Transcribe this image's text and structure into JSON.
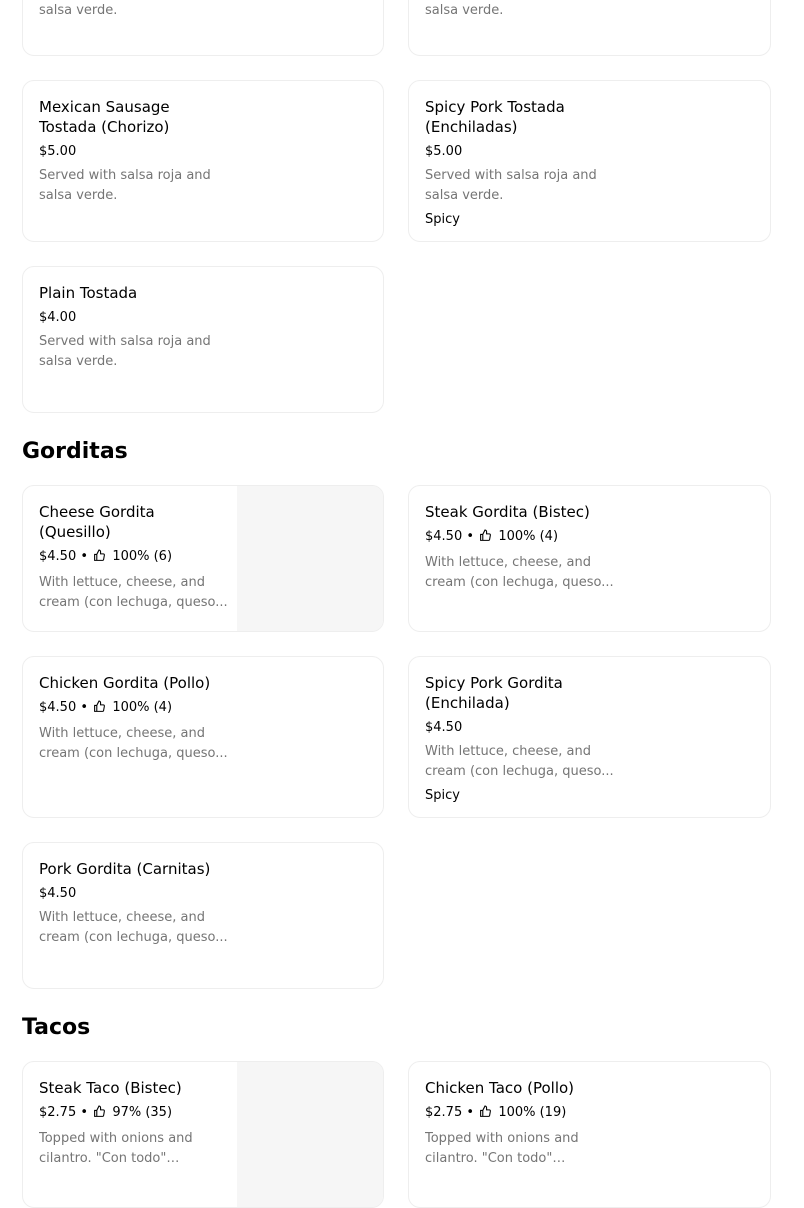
{
  "tostadas_top": {
    "left_desc_tail": "salsa verde.",
    "right_desc_tail": "salsa verde."
  },
  "tostadas": [
    {
      "title": "Mexican Sausage Tostada (Chorizo)",
      "price": "$5.00",
      "desc": "Served with salsa roja and salsa verde."
    },
    {
      "title": "Spicy Pork Tostada (Enchiladas)",
      "price": "$5.00",
      "desc": "Served with salsa roja and salsa verde.",
      "tag": "Spicy"
    },
    {
      "title": "Plain Tostada",
      "price": "$4.00",
      "desc": "Served with salsa roja and salsa verde."
    }
  ],
  "gorditas": {
    "heading": "Gorditas",
    "items": [
      {
        "title": "Cheese Gordita (Quesillo)",
        "price": "$4.50",
        "rating": "100% (6)",
        "desc": "With lettuce, cheese, and cream (con lechuga, queso..."
      },
      {
        "title": "Steak Gordita (Bistec)",
        "price": "$4.50",
        "rating": "100% (4)",
        "desc": "With lettuce, cheese, and cream (con lechuga, queso..."
      },
      {
        "title": "Chicken Gordita (Pollo)",
        "price": "$4.50",
        "rating": "100% (4)",
        "desc": "With lettuce, cheese, and cream (con lechuga, queso..."
      },
      {
        "title": "Spicy Pork Gordita (Enchilada)",
        "price": "$4.50",
        "desc": "With lettuce, cheese, and cream (con lechuga, queso...",
        "tag": "Spicy"
      },
      {
        "title": "Pork Gordita (Carnitas)",
        "price": "$4.50",
        "desc": "With lettuce, cheese, and cream (con lechuga, queso..."
      }
    ]
  },
  "tacos": {
    "heading": "Tacos",
    "items": [
      {
        "title": "Steak Taco (Bistec)",
        "price": "$2.75",
        "rating": "97% (35)",
        "desc": "Topped with onions and cilantro. \"Con todo\" include..."
      },
      {
        "title": "Chicken Taco (Pollo)",
        "price": "$2.75",
        "rating": "100% (19)",
        "desc": "Topped with onions and cilantro. \"Con todo\" include..."
      }
    ]
  },
  "separator": "•",
  "icons": {
    "rating": "thumbs-up-icon"
  }
}
